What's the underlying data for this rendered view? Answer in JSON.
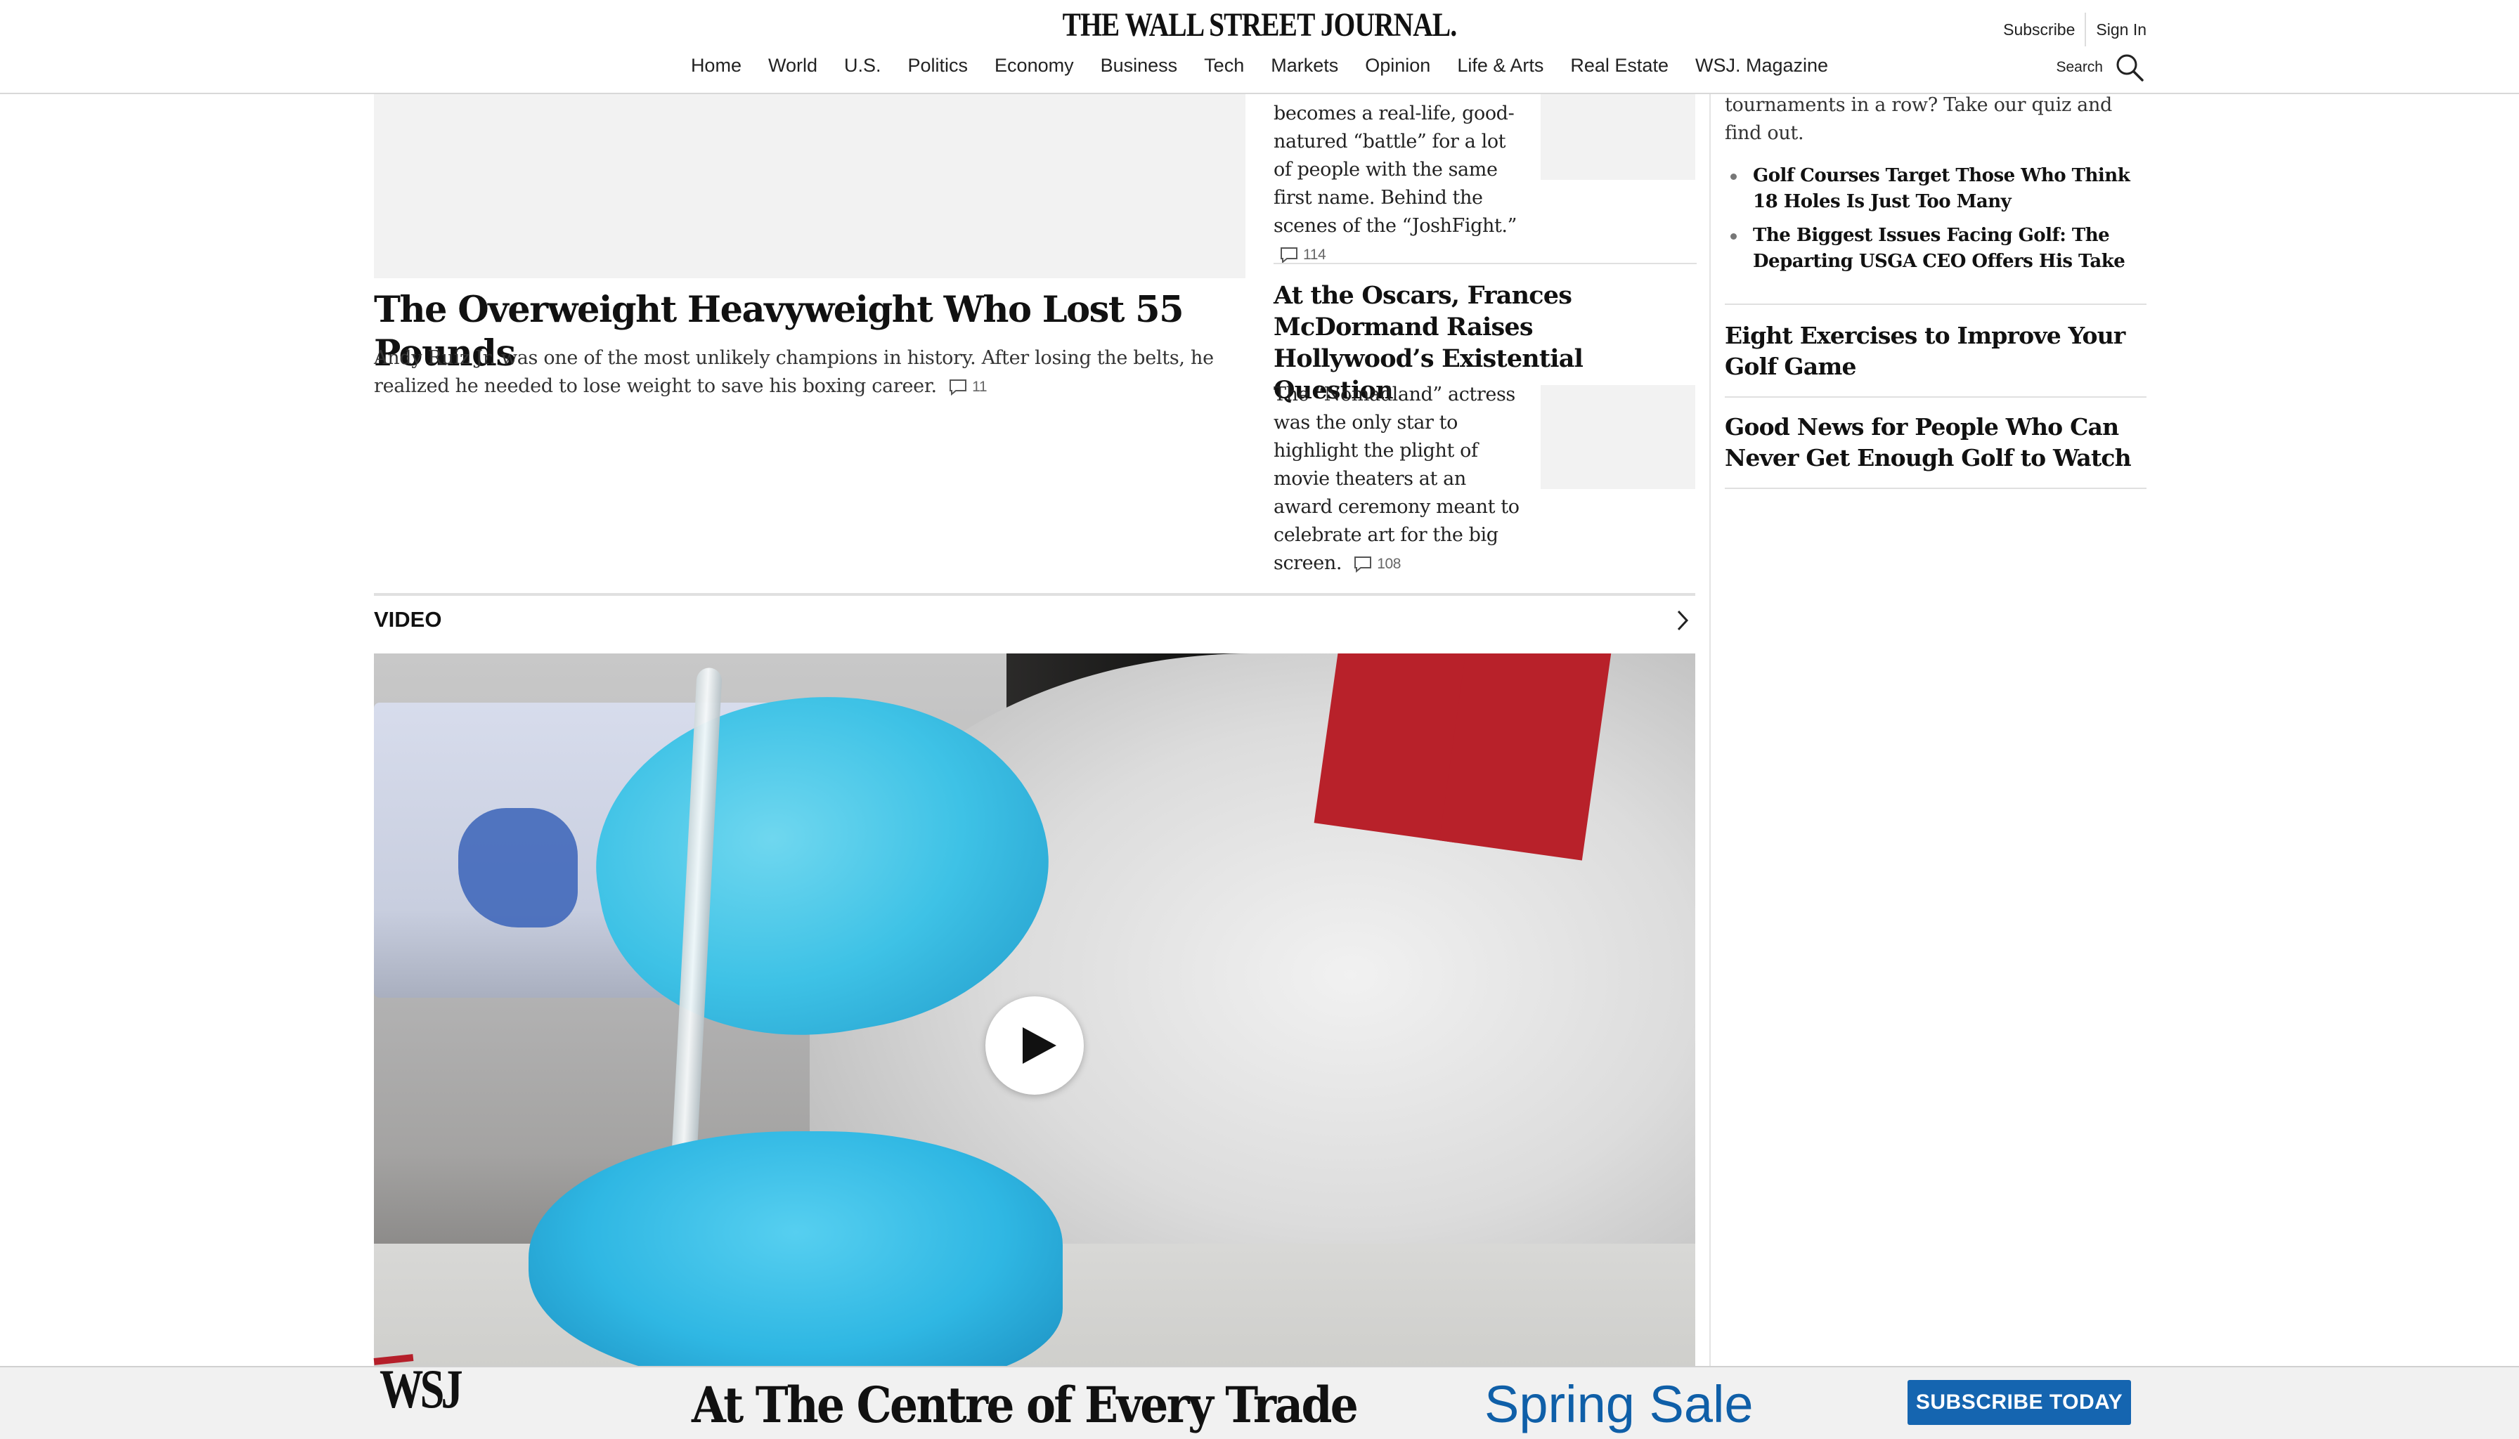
{
  "header": {
    "logo": "THE WALL STREET JOURNAL.",
    "subscribe": "Subscribe",
    "sign_in": "Sign In",
    "search_label": "Search",
    "nav": [
      "Home",
      "World",
      "U.S.",
      "Politics",
      "Economy",
      "Business",
      "Tech",
      "Markets",
      "Opinion",
      "Life & Arts",
      "Real Estate",
      "WSJ. Magazine"
    ]
  },
  "lead": {
    "title": "The Overweight Heavyweight Who Lost 55 Pounds",
    "summary": "Andy Ruiz Jr. was one of the most unlikely champions in history. After losing the belts, he realized he needed to lose weight to save his boxing career.",
    "comments": "11"
  },
  "middle": {
    "story1": {
      "summary": "becomes a real-life, good-natured “battle” for a lot of people with the same first name. Behind the scenes of the “JoshFight.”",
      "comments": "114"
    },
    "story2": {
      "title": "At the Oscars, Frances McDormand Raises Hollywood’s Existential Question",
      "summary": "The “Nomadland” actress was the only star to highlight the plight of movie theaters at an award ceremony meant to celebrate art for the big screen.",
      "comments": "108"
    }
  },
  "right": {
    "intro": "tournaments in a row? Take our quiz and find out.",
    "bullets": [
      "Golf Courses Target Those Who Think 18 Holes Is Just Too Many",
      "The Biggest Issues Facing Golf: The Departing USGA CEO Offers His Take"
    ],
    "stories": [
      "Eight Exercises to Improve Your Golf Game",
      "Good News for People Who Can Never Get Enough Golf to Watch"
    ]
  },
  "video": {
    "section_label": "VIDEO"
  },
  "banner": {
    "brand": "WSJ",
    "tagline": "At The Centre of Every Trade",
    "sale": "Spring Sale",
    "cta": "SUBSCRIBE TODAY",
    "sale_color": "#0f5fa8",
    "cta_color": "#1565b0"
  }
}
